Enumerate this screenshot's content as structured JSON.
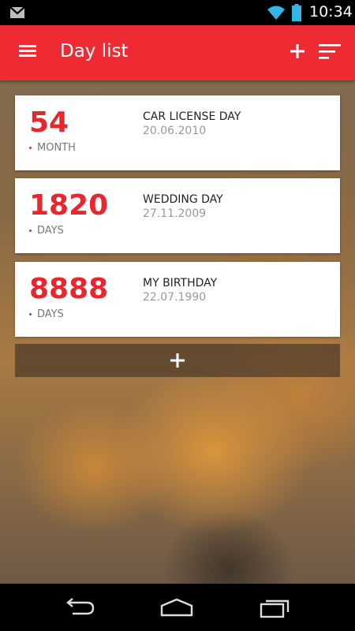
{
  "status_bar": {
    "time": "10:34",
    "icons": [
      "gmail-icon",
      "wifi-icon",
      "battery-icon"
    ]
  },
  "app_bar": {
    "title": "Day list",
    "icons": [
      "menu-icon",
      "add-icon",
      "sort-icon"
    ],
    "color": "#ee2b32"
  },
  "items": [
    {
      "count": "54",
      "unit": "MONTH",
      "name": "CAR LICENSE DAY",
      "date": "20.06.2010"
    },
    {
      "count": "1820",
      "unit": "DAYS",
      "name": "WEDDING DAY",
      "date": "27.11.2009"
    },
    {
      "count": "8888",
      "unit": "DAYS",
      "name": "MY BIRTHDAY",
      "date": "22.07.1990"
    }
  ],
  "add_row": {
    "icon": "plus-icon"
  },
  "nav_bar": {
    "icons": [
      "back-icon",
      "home-icon",
      "recents-icon"
    ]
  },
  "colors": {
    "accent": "#e8262e",
    "card": "#ffffff",
    "muted": "#999999"
  }
}
